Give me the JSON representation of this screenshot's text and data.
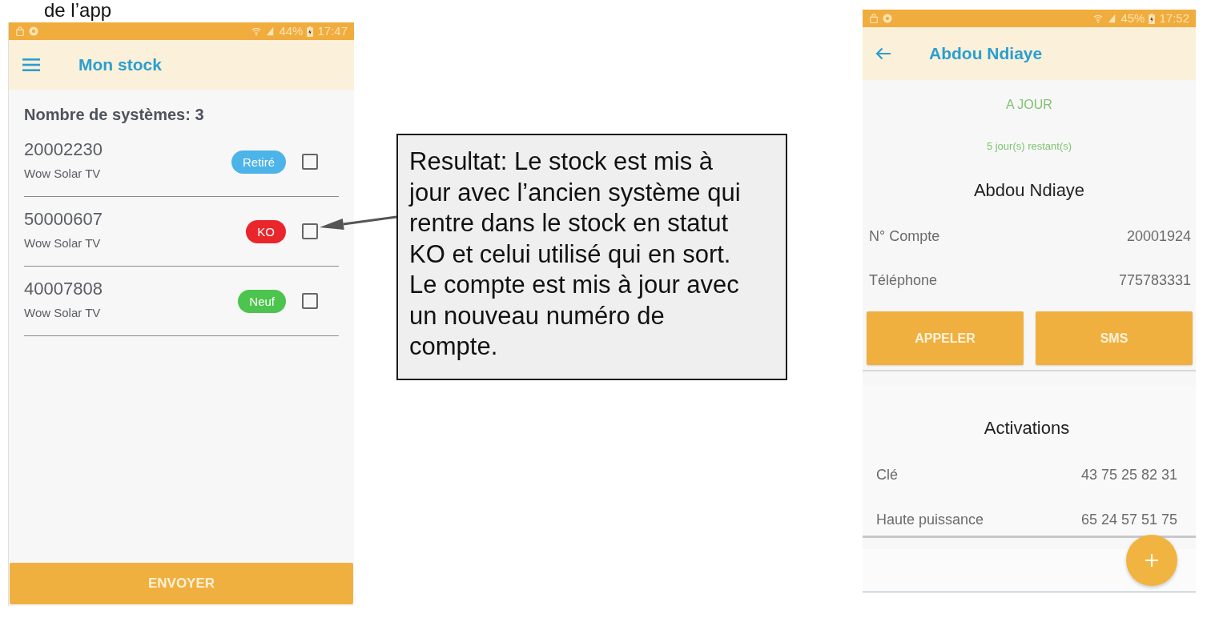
{
  "slide_title": "de l’app",
  "stock_screen": {
    "status_bar": {
      "battery": "44%",
      "time": "17:47"
    },
    "title": "Mon stock",
    "count_label": "Nombre de systèmes: 3",
    "systems": [
      {
        "serial": "20002230",
        "product": "Wow Solar TV",
        "status": "Retiré",
        "color": "#4cb4e8",
        "checked": false
      },
      {
        "serial": "50000607",
        "product": "Wow Solar TV",
        "status": "KO",
        "color": "#e8262c",
        "checked": false
      },
      {
        "serial": "40007808",
        "product": "Wow Solar TV",
        "status": "Neuf",
        "color": "#4cc44e",
        "checked": false
      }
    ],
    "send_button": "ENVOYER"
  },
  "callout": {
    "text": "Resultat: Le stock est mis à\njour avec l’ancien système qui\nrentre dans le stock en statut\nKO et celui utilisé qui en sort.\nLe compte est mis à jour avec\nun nouveau numéro de\ncompte."
  },
  "client_screen": {
    "status_bar": {
      "battery": "45%",
      "time": "17:52"
    },
    "title": "Abdou Ndiaye",
    "account_status": "A JOUR",
    "days_remaining": "5 jour(s) restant(s)",
    "client_name": "Abdou Ndiaye",
    "details": [
      {
        "label": "N° Compte",
        "value": "20001924"
      },
      {
        "label": "Téléphone",
        "value": "775783331"
      }
    ],
    "actions": [
      "APPELER",
      "SMS"
    ],
    "activations": {
      "title": "Activations",
      "rows": [
        {
          "label": "Clé",
          "value": "43 75 25 82 31"
        },
        {
          "label": "Haute puissance",
          "value": "65 24 57 51 75"
        }
      ]
    }
  }
}
